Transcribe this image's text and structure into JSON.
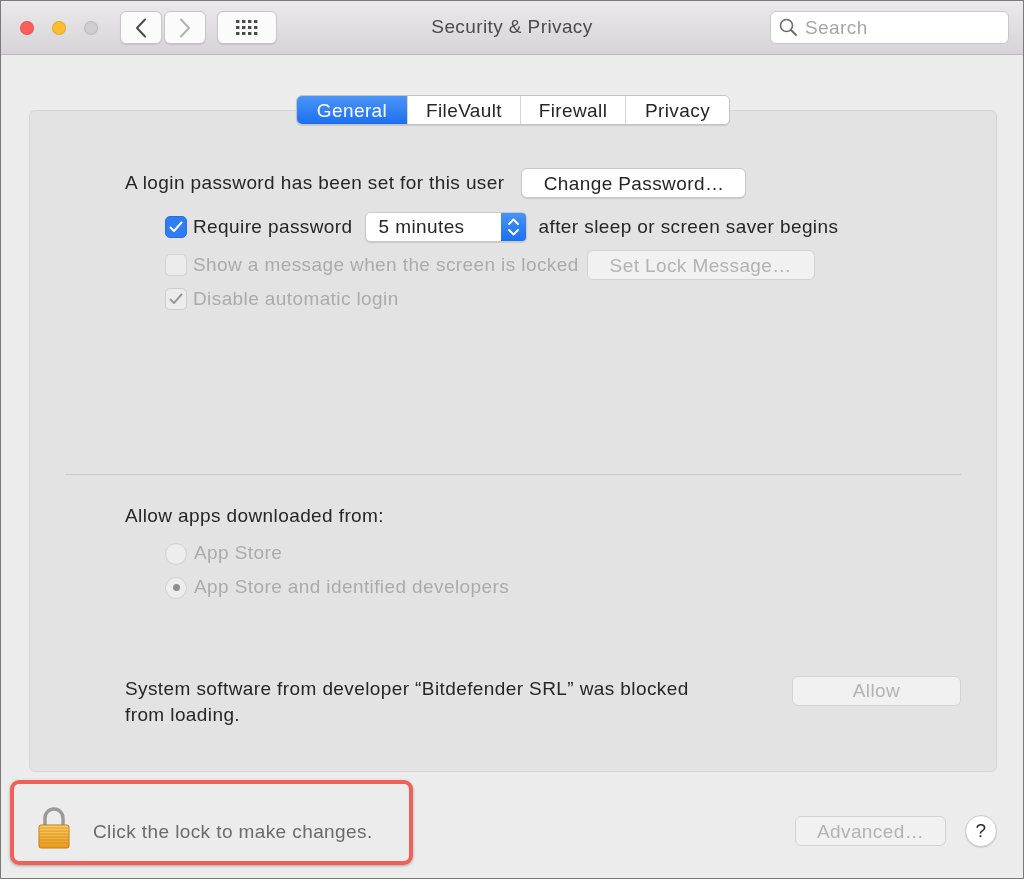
{
  "window": {
    "title": "Security & Privacy",
    "controls": [
      {
        "kind": "close",
        "disabled": false
      },
      {
        "kind": "minimize",
        "disabled": false
      },
      {
        "kind": "zoom",
        "disabled": true
      }
    ]
  },
  "toolbar": {
    "nav": [
      {
        "kind": "back",
        "disabled": false
      },
      {
        "kind": "forward",
        "disabled": true
      }
    ],
    "search": {
      "placeholder": "Search"
    }
  },
  "tabs": [
    {
      "label": "General",
      "selected": true
    },
    {
      "label": "FileVault",
      "selected": false
    },
    {
      "label": "Firewall",
      "selected": false
    },
    {
      "label": "Privacy",
      "selected": false
    }
  ],
  "general": {
    "password_label": "A login password has been set for this user",
    "change_password_button": {
      "label": "Change Password…",
      "disabled": false
    },
    "options": [
      {
        "label": "Require password",
        "checked": true,
        "disabled": false,
        "popup": {
          "value": "5 minutes"
        },
        "suffix": "after sleep or screen saver begins"
      },
      {
        "label": "Show a message when the screen is locked",
        "checked": false,
        "disabled": true,
        "button": {
          "label": "Set Lock Message…",
          "disabled": true
        }
      },
      {
        "label": "Disable automatic login",
        "checked": true,
        "disabled": true
      }
    ]
  },
  "allow_apps": {
    "heading": "Allow apps downloaded from:",
    "disabled": true,
    "options": [
      {
        "label": "App Store",
        "selected": false
      },
      {
        "label": "App Store and identified developers",
        "selected": true
      }
    ]
  },
  "blocked": {
    "message": "System software from developer “Bitdefender SRL” was blocked from loading.",
    "button": {
      "label": "Allow",
      "disabled": true
    }
  },
  "footer": {
    "highlighted": true,
    "locked": true,
    "lock_message": "Click the lock to make changes.",
    "advanced_button": {
      "label": "Advanced…",
      "disabled": true
    },
    "help": "?"
  }
}
